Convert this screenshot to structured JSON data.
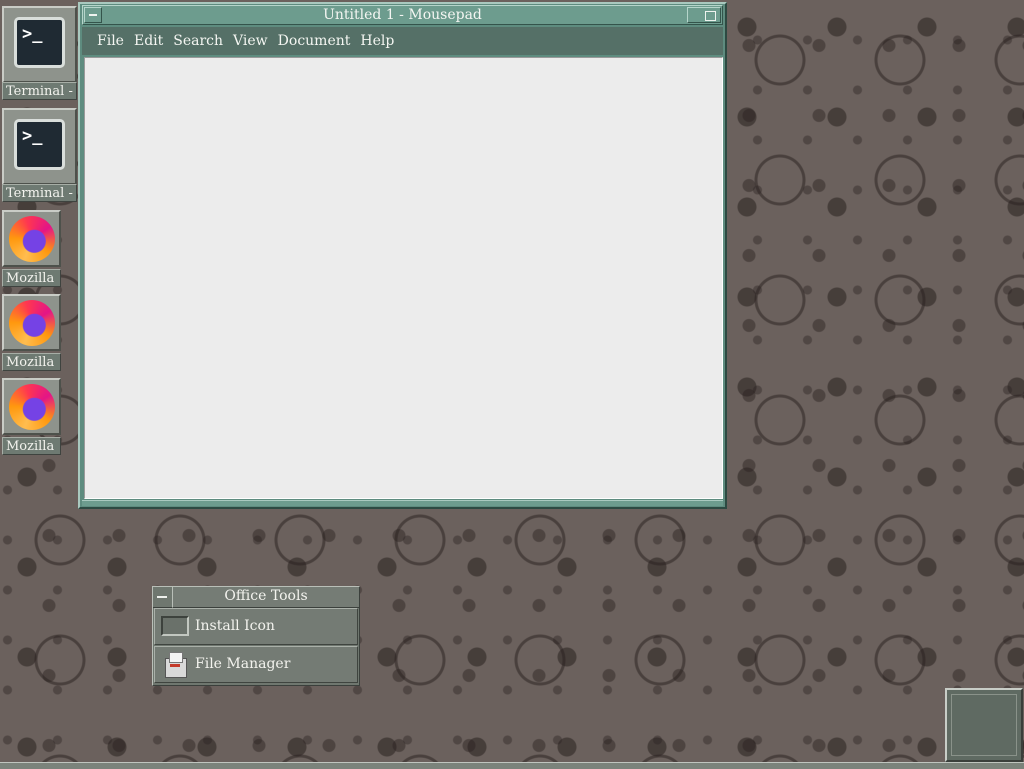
{
  "desktop": {
    "terminals": [
      {
        "label": "Terminal -",
        "glyph": ">_"
      },
      {
        "label": "Terminal -",
        "glyph": ">_"
      }
    ],
    "browsers": [
      {
        "label": "Mozilla"
      },
      {
        "label": "Mozilla"
      },
      {
        "label": "Mozilla"
      }
    ]
  },
  "window": {
    "title": "Untitled 1 - Mousepad",
    "menus": [
      "File",
      "Edit",
      "Search",
      "View",
      "Document",
      "Help"
    ],
    "content": ""
  },
  "office_tools": {
    "title": "Office Tools",
    "items": [
      {
        "label": "Install Icon",
        "icon": "install-icon"
      },
      {
        "label": "File Manager",
        "icon": "file-manager-icon"
      }
    ]
  },
  "colors": {
    "window_accent": "#6d9c8e",
    "panel": "#6f776f",
    "desktop": "#6b615d"
  }
}
